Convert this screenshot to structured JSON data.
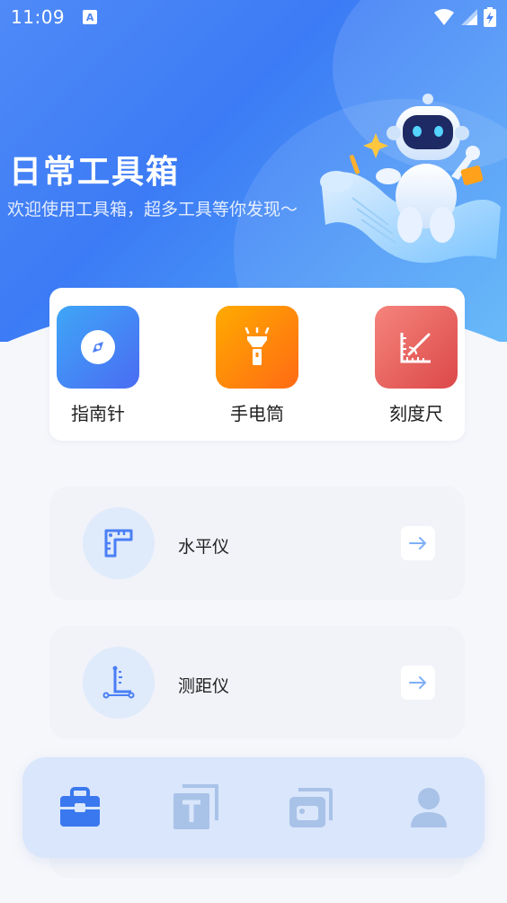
{
  "status_bar": {
    "time": "11:09",
    "notification_badge": "A",
    "icons": [
      "wifi-icon",
      "signal-icon",
      "battery-charging-icon"
    ]
  },
  "hero": {
    "title": "日常工具箱",
    "subtitle": "欢迎使用工具箱，超多工具等你发现～",
    "illustration": "robot-on-paper-scroll"
  },
  "quick_tools": [
    {
      "label": "指南针",
      "icon": "compass-icon",
      "color_from": "#3fa2f6",
      "color_to": "#4a6ff4"
    },
    {
      "label": "手电筒",
      "icon": "flashlight-icon",
      "color_from": "#ffa800",
      "color_to": "#ff6b12"
    },
    {
      "label": "刻度尺",
      "icon": "ruler-angle-icon",
      "color_from": "#f2867f",
      "color_to": "#dc4a4a"
    }
  ],
  "tool_list": [
    {
      "label": "水平仪",
      "icon": "level-ruler-icon"
    },
    {
      "label": "测距仪",
      "icon": "rangefinder-icon"
    }
  ],
  "bottom_nav": [
    {
      "name": "toolbox",
      "icon": "toolbox-icon",
      "active": true
    },
    {
      "name": "text",
      "icon": "text-tool-icon",
      "active": false
    },
    {
      "name": "gallery",
      "icon": "gallery-icon",
      "active": false
    },
    {
      "name": "profile",
      "icon": "user-icon",
      "active": false
    }
  ],
  "colors": {
    "brand": "#3c7bf5",
    "hero_light": "#58b2f9",
    "page_bg": "#f6f7fb",
    "nav_bg": "#d9e6fb",
    "nav_active": "#3a78f0",
    "nav_inactive": "#a9c2e8"
  }
}
